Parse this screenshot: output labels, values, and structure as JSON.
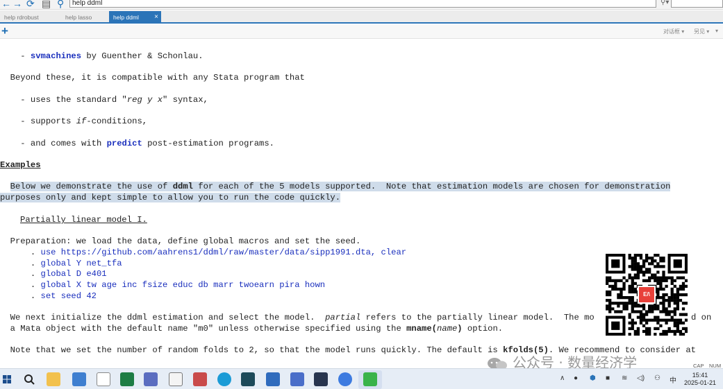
{
  "browser": {
    "address": "help ddml",
    "find_text": ""
  },
  "tabs": [
    {
      "label": "help rdrobust"
    },
    {
      "label": "help lasso"
    },
    {
      "label": "help ddml",
      "close": "×"
    }
  ],
  "toolbar": {
    "plus": "+",
    "dialog_label": "对话框 ▾",
    "also_see_label": "另见 ▾",
    "jump_label": "▾"
  },
  "doc": {
    "svm_bullet_prefix": "    - ",
    "svm_link": "svmachines",
    "svm_suffix": " by Guenther & Schonlau.",
    "compat": "  Beyond these, it is compatible with any Stata program that",
    "b1_prefix": "    - uses the standard \"",
    "b1_italic": "reg y x",
    "b1_suffix": "\" syntax,",
    "b2_prefix": "    - supports ",
    "b2_italic": "if",
    "b2_suffix": "-conditions,",
    "b3_prefix": "    - and comes with ",
    "b3_link": "predict",
    "b3_suffix": " post-estimation programs.",
    "examples_heading": "Examples",
    "ex1_indent": "  ",
    "ex1_a": "Below we demonstrate the use of ",
    "ex1_bold": "ddml",
    "ex1_b": " for each of the 5 models supported.  Note that estimation models are chosen for demonstration",
    "ex2": "purposes only and kept simple to allow you to run the code quickly.",
    "plm_heading": "Partially linear model I.",
    "prep": "  Preparation: we load the data, define global macros and set the seed.",
    "cmd_prefix": "      . ",
    "cmd1": "use https://github.com/aahrens1/ddml/raw/master/data/sipp1991.dta, clear",
    "cmd2": "global Y net_tfa",
    "cmd3": "global D e401",
    "cmd4": "global X tw age inc fsize educ db marr twoearn pira hown",
    "cmd5": "set seed 42",
    "init_a": "  We next initialize the ddml estimation and select the model.  ",
    "init_italic": "partial",
    "init_b": " refers to the partially linear model.  The mo",
    "init_c": "d on",
    "mata_a": "  a Mata object with the default name \"m0\" unless otherwise specified using the ",
    "mata_bold": "mname(",
    "mata_italic": "name",
    "mata_bold2": ")",
    "mata_b": " option.",
    "folds_a": "  Note that we set the number of random folds to 2, so that the model runs quickly. The default is ",
    "folds_bold": "kfolds(5)",
    "folds_b": ". We recommend to consider at"
  },
  "qr_logo": "E/\\",
  "watermark": {
    "text": "公众号 · 数量经济学"
  },
  "status": {
    "cap": "CAP",
    "num": "NUM"
  },
  "taskbar": {
    "time": "15:41",
    "date": "2025-01-21",
    "start_color": "#1a4c8c",
    "accent": "#2b74b8"
  }
}
